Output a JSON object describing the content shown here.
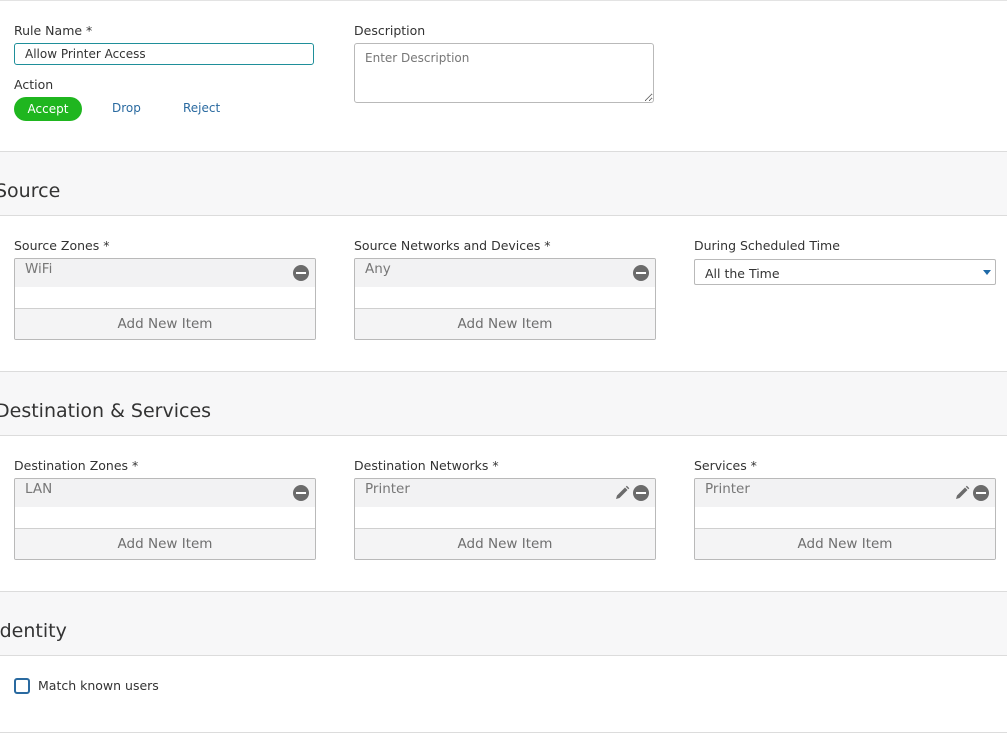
{
  "rule": {
    "name_label": "Rule Name *",
    "name_value": "Allow Printer Access",
    "description_label": "Description",
    "description_placeholder": "Enter Description",
    "action_label": "Action",
    "actions": {
      "accept": "Accept",
      "drop": "Drop",
      "reject": "Reject"
    },
    "selected_action": "Accept"
  },
  "source": {
    "title": "Source",
    "zones": {
      "label": "Source Zones *",
      "item": "WiFi",
      "add": "Add New Item"
    },
    "networks": {
      "label": "Source Networks and Devices *",
      "item": "Any",
      "add": "Add New Item"
    },
    "schedule": {
      "label": "During Scheduled Time",
      "value": "All the Time"
    }
  },
  "destination": {
    "title": "Destination & Services",
    "zones": {
      "label": "Destination Zones *",
      "item": "LAN",
      "add": "Add New Item"
    },
    "networks": {
      "label": "Destination Networks *",
      "item": "Printer",
      "add": "Add New Item"
    },
    "services": {
      "label": "Services *",
      "item": "Printer",
      "add": "Add New Item"
    }
  },
  "identity": {
    "title": "Identity",
    "match_known_users": "Match known users",
    "match_known_users_checked": false
  },
  "colors": {
    "accept_green": "#1fb61f",
    "link_blue": "#2a6aa0",
    "input_focus": "#1f8f9a"
  },
  "icons": [
    "remove-circle-icon",
    "pencil-icon",
    "chevron-down-icon"
  ]
}
